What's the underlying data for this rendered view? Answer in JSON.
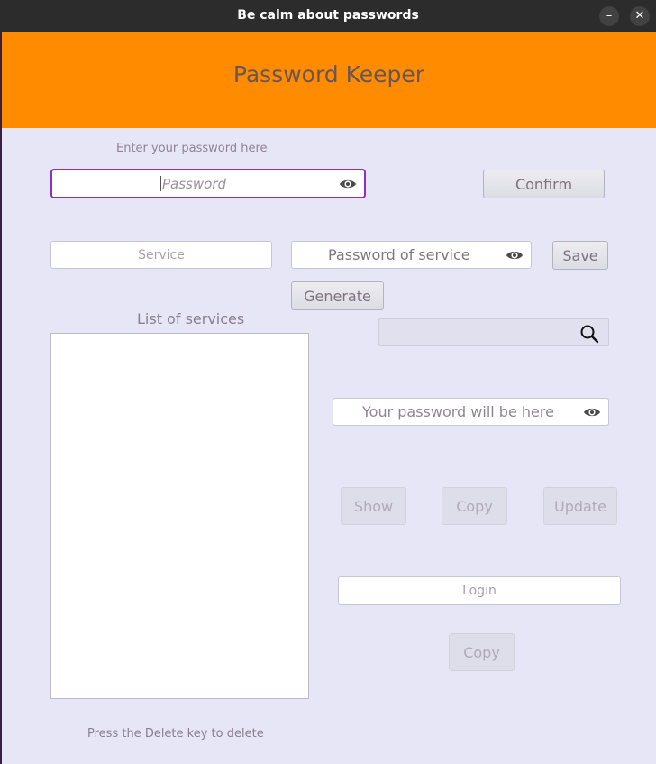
{
  "window": {
    "title": "Be calm about passwords",
    "minimize_icon": "–",
    "close_icon": "✕"
  },
  "header": {
    "app_title": "Password Keeper"
  },
  "master": {
    "label": "Enter your password here",
    "password_placeholder": "Password",
    "confirm_label": "Confirm"
  },
  "service_entry": {
    "service_placeholder": "Service",
    "service_password_placeholder": "Password of service",
    "save_label": "Save",
    "generate_label": "Generate"
  },
  "services": {
    "list_label": "List of services",
    "items": [],
    "delete_hint": "Press the Delete key to delete"
  },
  "search": {
    "value": ""
  },
  "result": {
    "password_placeholder": "Your password will be here",
    "show_label": "Show",
    "copy_label": "Copy",
    "update_label": "Update",
    "login_placeholder": "Login",
    "login_copy_label": "Copy"
  },
  "colors": {
    "header_orange": "#ff8b00",
    "background": "#e6e6f6",
    "focus_purple": "#8c2ec7"
  },
  "icons": {
    "eye": "eye-icon",
    "search": "search-icon"
  }
}
